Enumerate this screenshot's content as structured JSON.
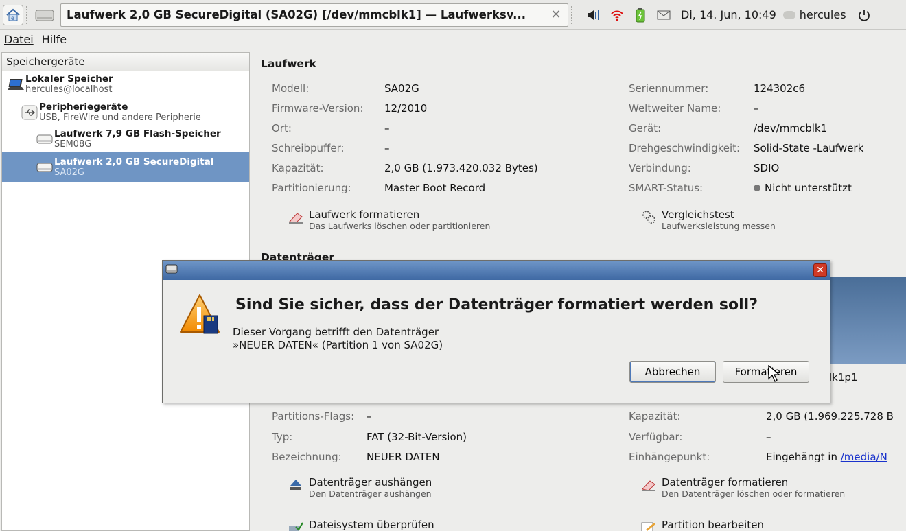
{
  "taskbar": {
    "window_title": "Laufwerk 2,0 GB SecureDigital (SA02G) [/dev/mmcblk1] — Laufwerksv...",
    "clock": "Di, 14. Jun, 10:49",
    "user": "hercules",
    "icons": [
      "home-icon",
      "drive-icon",
      "close-icon",
      "volume-icon",
      "wifi-icon",
      "battery-icon",
      "mail-icon",
      "user-icon",
      "power-icon"
    ]
  },
  "menubar": {
    "file": "Datei",
    "help": "Hilfe"
  },
  "sidebar": {
    "header": "Speichergeräte",
    "items": [
      {
        "title": "Lokaler Speicher",
        "subtitle": "hercules@localhost"
      },
      {
        "title": "Peripheriegeräte",
        "subtitle": "USB, FireWire und andere Peripherie"
      },
      {
        "title": "Laufwerk 7,9 GB Flash-Speicher",
        "subtitle": "SEM08G"
      },
      {
        "title": "Laufwerk 2,0 GB SecureDigital",
        "subtitle": "SA02G",
        "selected": true
      }
    ]
  },
  "drive": {
    "section_title": "Laufwerk",
    "left": [
      {
        "key": "Modell:",
        "value": "SA02G"
      },
      {
        "key": "Firmware-Version:",
        "value": "12/2010"
      },
      {
        "key": "Ort:",
        "value": "–"
      },
      {
        "key": "Schreibpuffer:",
        "value": "–"
      },
      {
        "key": "Kapazität:",
        "value": "2,0 GB (1.973.420.032 Bytes)"
      },
      {
        "key": "Partitionierung:",
        "value": "Master Boot Record"
      }
    ],
    "right": [
      {
        "key": "Seriennummer:",
        "value": "124302c6"
      },
      {
        "key": "Weltweiter Name:",
        "value": "–"
      },
      {
        "key": "Gerät:",
        "value": "/dev/mmcblk1"
      },
      {
        "key": "Drehgeschwindigkeit:",
        "value": "Solid-State -Laufwerk"
      },
      {
        "key": "Verbindung:",
        "value": "SDIO"
      },
      {
        "key": "SMART-Status:",
        "value": "Nicht unterstützt"
      }
    ],
    "format_action": {
      "label": "Laufwerk formatieren",
      "desc": "Das Laufwerks löschen oder partitionieren"
    },
    "benchmark_action": {
      "label": "Vergleichstest",
      "desc": "Laufwerksleistung messen"
    }
  },
  "volumes": {
    "section_title": "Datenträger",
    "device_partial": "lk1p1",
    "left": [
      {
        "key": "Partitions-Flags:",
        "value": "–"
      },
      {
        "key": "Typ:",
        "value": "FAT (32-Bit-Version)"
      },
      {
        "key": "Bezeichnung:",
        "value": "NEUER DATEN"
      }
    ],
    "right": [
      {
        "key": "Kapazität:",
        "value": "2,0 GB (1.969.225.728 B"
      },
      {
        "key": "Verfügbar:",
        "value": "–"
      },
      {
        "key": "Einhängepunkt:",
        "value": "Eingehängt in",
        "link": "/media/N"
      }
    ],
    "actions": [
      {
        "label": "Datenträger aushängen",
        "desc": "Den Datenträger aushängen"
      },
      {
        "label": "Datenträger formatieren",
        "desc": "Den Datenträger löschen oder formatieren"
      },
      {
        "label": "Dateisystem überprüfen",
        "desc": ""
      },
      {
        "label": "Partition bearbeiten",
        "desc": ""
      }
    ]
  },
  "dialog": {
    "heading": "Sind Sie sicher, dass der Datenträger formatiert werden soll?",
    "body_line1": "Dieser Vorgang betrifft den Datenträger",
    "body_line2": "»NEUER DATEN« (Partition 1 von SA02G)",
    "cancel_label": "Abbrechen",
    "format_label": "Formatieren"
  }
}
